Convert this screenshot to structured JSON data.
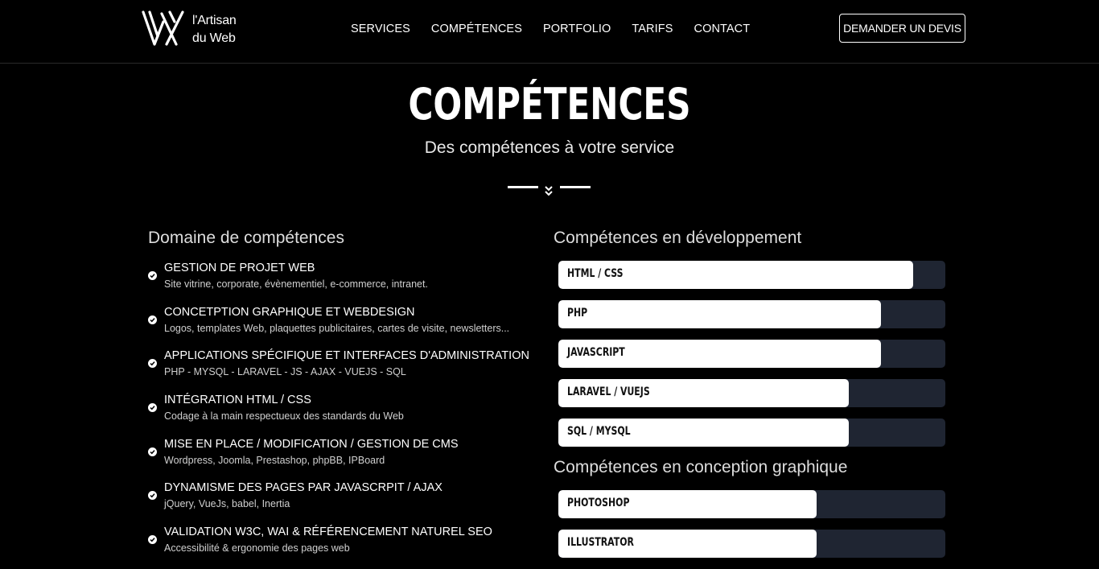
{
  "brand": {
    "line1": "l'Artisan",
    "line2": "du Web"
  },
  "nav": [
    {
      "label": "SERVICES"
    },
    {
      "label": "COMPÉTENCES"
    },
    {
      "label": "PORTFOLIO"
    },
    {
      "label": "TARIFS"
    },
    {
      "label": "CONTACT"
    }
  ],
  "cta_label": "DEMANDER UN DEVIS",
  "hero": {
    "title": "COMPÉTENCES",
    "subtitle": "Des compétences à votre service"
  },
  "domain": {
    "title": "Domaine de compétences",
    "items": [
      {
        "name": "GESTION DE PROJET WEB",
        "desc": "Site vitrine, corporate, évènementiel, e-commerce, intranet."
      },
      {
        "name": "CONCETPTION GRAPHIQUE ET WEBDESIGN",
        "desc": "Logos, templates Web, plaquettes publicitaires, cartes de visite, newsletters..."
      },
      {
        "name": "APPLICATIONS SPÉCIFIQUE ET INTERFACES D'ADMINISTRATION",
        "desc": "PHP - MYSQL - LARAVEL - JS - AJAX - VUEJS - SQL"
      },
      {
        "name": "INTÉGRATION HTML / CSS",
        "desc": "Codage à la main respectueux des standards du Web"
      },
      {
        "name": "MISE EN PLACE / MODIFICATION / GESTION DE CMS",
        "desc": "Wordpress, Joomla, Prestashop, phpBB, IPBoard"
      },
      {
        "name": "DYNAMISME DES PAGES PAR JAVASCRPIT / AJAX",
        "desc": "jQuery, VueJs, babel, Inertia"
      },
      {
        "name": "VALIDATION W3C, WAI & RÉFÉRENCEMENT NATUREL SEO",
        "desc": "Accessibilité & ergonomie des pages web"
      }
    ]
  },
  "dev": {
    "title": "Compétences en développement",
    "bars": [
      {
        "label": "HTML / CSS",
        "level": 0.917
      },
      {
        "label": "PHP",
        "level": 0.834
      },
      {
        "label": "JAVASCRIPT",
        "level": 0.834
      },
      {
        "label": "LARAVEL / VUEJS",
        "level": 0.751
      },
      {
        "label": "SQL / MYSQL",
        "level": 0.751
      }
    ]
  },
  "design": {
    "title": "Compétences en conception graphique",
    "bars": [
      {
        "label": "PHOTOSHOP",
        "level": 0.667
      },
      {
        "label": "ILLUSTRATOR",
        "level": 0.667
      }
    ]
  },
  "colors": {
    "background": "#000000",
    "bar_track": "#1f2532",
    "bar_fill": "#ffffff"
  }
}
